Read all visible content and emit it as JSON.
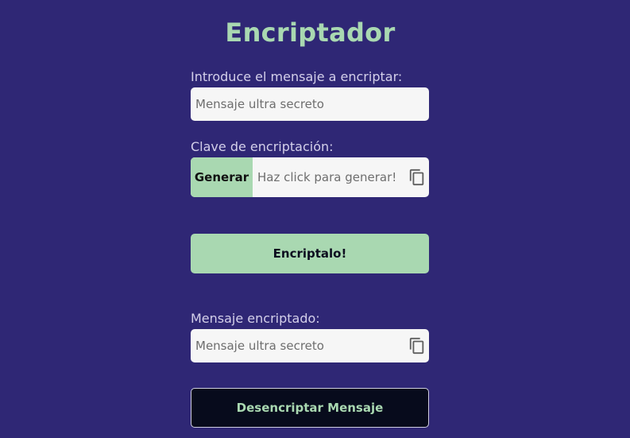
{
  "header": {
    "title": "Encriptador"
  },
  "message_section": {
    "label": "Introduce el mensaje a encriptar:",
    "placeholder": "Mensaje ultra secreto",
    "value": ""
  },
  "key_section": {
    "label": "Clave de encriptación:",
    "generate_label": "Generar",
    "placeholder": "Haz click para generar!",
    "value": "",
    "copy_icon": "copy-icon"
  },
  "encrypt_button": {
    "label": "Encriptalo!"
  },
  "result_section": {
    "label": "Mensaje encriptado:",
    "placeholder": "Mensaje ultra secreto",
    "value": "",
    "copy_icon": "copy-icon"
  },
  "decrypt_button": {
    "label": "Desencriptar Mensaje"
  },
  "colors": {
    "background": "#2f2775",
    "accent": "#a9d8b1",
    "input_bg": "#f6f6f6",
    "dark_button": "#070b1c"
  }
}
